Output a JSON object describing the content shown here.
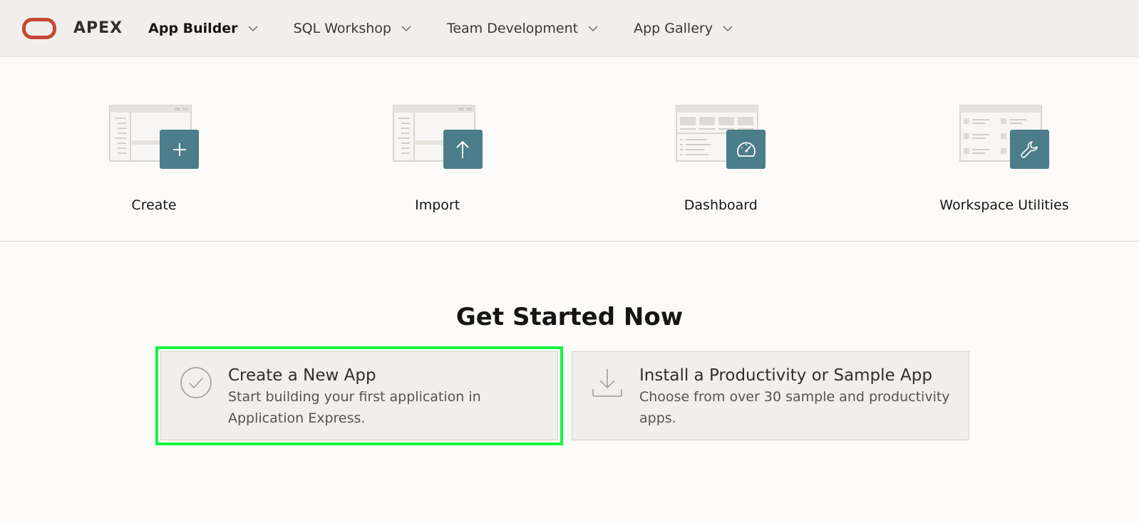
{
  "header": {
    "brand": "APEX",
    "nav": [
      {
        "label": "App Builder",
        "active": true
      },
      {
        "label": "SQL Workshop",
        "active": false
      },
      {
        "label": "Team Development",
        "active": false
      },
      {
        "label": "App Gallery",
        "active": false
      }
    ]
  },
  "tiles": [
    {
      "label": "Create",
      "icon": "plus-icon"
    },
    {
      "label": "Import",
      "icon": "upload-arrow-icon"
    },
    {
      "label": "Dashboard",
      "icon": "gauge-icon"
    },
    {
      "label": "Workspace Utilities",
      "icon": "wrench-icon"
    }
  ],
  "get_started": {
    "title": "Get Started Now",
    "cards": [
      {
        "title": "Create a New App",
        "description": "Start building your first application in Application Express.",
        "icon": "checkmark-circle-icon",
        "highlighted": true
      },
      {
        "title": "Install a Productivity or Sample App",
        "description": "Choose from over 30 sample and productivity apps.",
        "icon": "download-tray-icon",
        "highlighted": false
      }
    ]
  },
  "colors": {
    "oracle_red": "#c74634",
    "tile_badge": "#4c7d8a",
    "highlight": "#14f53c"
  }
}
